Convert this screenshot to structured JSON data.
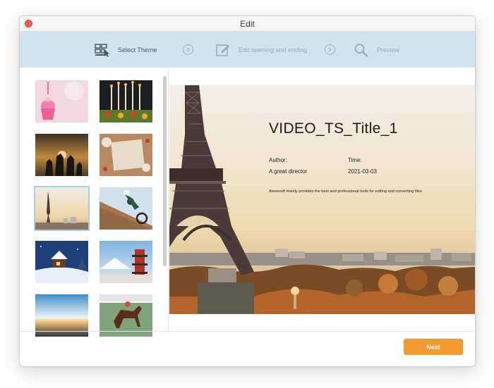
{
  "window": {
    "title": "Edit"
  },
  "steps": [
    {
      "label": "Select Theme",
      "icon": "grid-select-icon",
      "state": "active"
    },
    {
      "label": "Edit opening and ending",
      "icon": "edit-icon",
      "state": "inactive"
    },
    {
      "label": "Preview",
      "icon": "search-icon",
      "state": "inactive"
    }
  ],
  "themes": [
    {
      "icon": "birthday-cupcake-thumbnail"
    },
    {
      "icon": "birthday-candles-thumbnail"
    },
    {
      "icon": "family-sunset-thumbnail"
    },
    {
      "icon": "christmas-frame-thumbnail"
    },
    {
      "icon": "paris-eiffel-thumbnail",
      "selected": true
    },
    {
      "icon": "motocross-thumbnail"
    },
    {
      "icon": "winter-cabin-thumbnail"
    },
    {
      "icon": "japan-pagoda-thumbnail"
    },
    {
      "icon": "sea-sunset-thumbnail"
    },
    {
      "icon": "horse-racing-thumbnail"
    }
  ],
  "preview": {
    "title": "VIDEO_TS_Title_1",
    "author_label": "Author:",
    "author_value": "A great director",
    "time_label": "Time:",
    "time_value": "2021-03-03",
    "description": "Aiseesoft mainly provides the best and professional tools for editing and converting files."
  },
  "footer": {
    "next_label": "Next"
  },
  "colors": {
    "accent": "#f39a2e",
    "stepbar": "#cfe3f1",
    "selection": "#9fd0ec"
  }
}
